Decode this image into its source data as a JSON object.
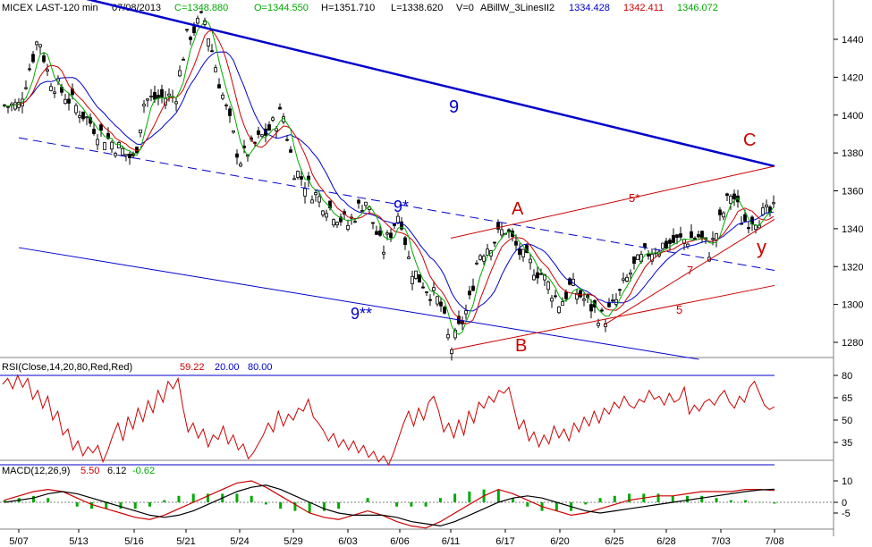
{
  "header": {
    "symbol": "MICEX LAST-120 min",
    "date": "07/08/2013",
    "close": "C=1348.880",
    "open": "O=1344.550",
    "high": "H=1351.710",
    "low": "L=1338.620",
    "volume": "V=0",
    "indicator": "ABillW_3LinesII2",
    "ind_blue": "1334.428",
    "ind_red": "1342.411",
    "ind_green": "1346.072"
  },
  "rsi_header": {
    "label": "RSI(Close,14,20,80,Red,Red)",
    "value": "59.22",
    "lower": "20.00",
    "upper": "80.00"
  },
  "macd_header": {
    "label": "MACD(12,26,9)",
    "macd": "5.50",
    "signal": "6.12",
    "hist": "-0.62"
  },
  "colors": {
    "price": "#000000",
    "blue": "#0000cc",
    "red": "#cc0000",
    "green": "#00aa00",
    "grid": "#808080"
  },
  "chart_data": [
    {
      "type": "candlestick",
      "title": "MICEX LAST-120 min",
      "x_ticks": [
        "5/07",
        "5/13",
        "5/16",
        "5/21",
        "5/24",
        "5/29",
        "6/03",
        "6/06",
        "6/11",
        "6/17",
        "6/20",
        "6/25",
        "6/28",
        "7/03",
        "7/08"
      ],
      "y_ticks": [
        1280,
        1300,
        1320,
        1340,
        1360,
        1380,
        1400,
        1420,
        1440
      ],
      "ylim": [
        1268,
        1452
      ],
      "grid": false,
      "key_points": [
        {
          "x": "5/07",
          "y": 1405
        },
        {
          "x": "5/09",
          "y": 1442
        },
        {
          "x": "5/10",
          "y": 1420
        },
        {
          "x": "5/13",
          "y": 1403
        },
        {
          "x": "5/14",
          "y": 1392
        },
        {
          "x": "5/16",
          "y": 1376
        },
        {
          "x": "5/17",
          "y": 1408
        },
        {
          "x": "5/20",
          "y": 1410
        },
        {
          "x": "5/21",
          "y": 1440
        },
        {
          "x": "5/22",
          "y": 1452
        },
        {
          "x": "5/23",
          "y": 1412
        },
        {
          "x": "5/24",
          "y": 1376
        },
        {
          "x": "5/27",
          "y": 1394
        },
        {
          "x": "5/28",
          "y": 1402
        },
        {
          "x": "5/29",
          "y": 1372
        },
        {
          "x": "5/31",
          "y": 1358
        },
        {
          "x": "6/03",
          "y": 1342
        },
        {
          "x": "6/04",
          "y": 1356
        },
        {
          "x": "6/05",
          "y": 1328
        },
        {
          "x": "6/06",
          "y": 1350
        },
        {
          "x": "6/07",
          "y": 1320
        },
        {
          "x": "6/10",
          "y": 1300
        },
        {
          "x": "6/11",
          "y": 1276
        },
        {
          "x": "6/13",
          "y": 1300
        },
        {
          "x": "6/14",
          "y": 1326
        },
        {
          "x": "6/17",
          "y": 1340
        },
        {
          "x": "6/18",
          "y": 1324
        },
        {
          "x": "6/19",
          "y": 1316
        },
        {
          "x": "6/20",
          "y": 1300
        },
        {
          "x": "6/21",
          "y": 1310
        },
        {
          "x": "6/24",
          "y": 1292
        },
        {
          "x": "6/25",
          "y": 1300
        },
        {
          "x": "6/26",
          "y": 1318
        },
        {
          "x": "6/27",
          "y": 1328
        },
        {
          "x": "6/28",
          "y": 1332
        },
        {
          "x": "7/01",
          "y": 1336
        },
        {
          "x": "7/02",
          "y": 1328
        },
        {
          "x": "7/03",
          "y": 1345
        },
        {
          "x": "7/04",
          "y": 1360
        },
        {
          "x": "7/05",
          "y": 1344
        },
        {
          "x": "7/08",
          "y": 1349
        }
      ],
      "channel_lines": [
        {
          "label": "9",
          "color": "#0000cc",
          "style": "solid",
          "from": {
            "x": "5/07",
            "y": 1470
          },
          "to": {
            "x": "7/08",
            "y": 1373
          }
        },
        {
          "label": "9*",
          "color": "#0000cc",
          "style": "dashed",
          "from": {
            "x": "5/07",
            "y": 1388
          },
          "to": {
            "x": "7/08",
            "y": 1318
          }
        },
        {
          "label": "9**",
          "color": "#0000cc",
          "style": "solid",
          "from": {
            "x": "5/07",
            "y": 1330
          },
          "to": {
            "x": "7/01",
            "y": 1271
          }
        },
        {
          "label": "5*",
          "color": "#cc0000",
          "style": "solid",
          "from": {
            "x": "6/11",
            "y": 1335
          },
          "to": {
            "x": "7/08",
            "y": 1373
          }
        },
        {
          "label": "5",
          "color": "#cc0000",
          "style": "solid",
          "from": {
            "x": "6/11",
            "y": 1276
          },
          "to": {
            "x": "7/08",
            "y": 1310
          }
        },
        {
          "label": "7",
          "color": "#cc0000",
          "style": "solid",
          "from": {
            "x": "6/24",
            "y": 1289
          },
          "to": {
            "x": "7/08",
            "y": 1345
          }
        }
      ],
      "annotations": [
        {
          "text": "9",
          "color": "#0000cc"
        },
        {
          "text": "9*",
          "color": "#0000cc"
        },
        {
          "text": "9**",
          "color": "#0000cc"
        },
        {
          "text": "A",
          "color": "#cc0000"
        },
        {
          "text": "B",
          "color": "#cc0000"
        },
        {
          "text": "C",
          "color": "#cc0000"
        },
        {
          "text": "5*",
          "color": "#cc0000"
        },
        {
          "text": "5",
          "color": "#cc0000"
        },
        {
          "text": "7",
          "color": "#cc0000"
        },
        {
          "text": "y",
          "color": "#cc0000"
        }
      ]
    },
    {
      "type": "line",
      "title": "RSI(Close,14,20,80,Red,Red)",
      "y_ticks": [
        35,
        50,
        65,
        80
      ],
      "ylim": [
        20,
        80
      ],
      "thresholds": [
        20,
        80
      ],
      "values": [
        74,
        78,
        71,
        80,
        72,
        78,
        64,
        70,
        58,
        66,
        50,
        56,
        40,
        44,
        30,
        36,
        26,
        32,
        28,
        33,
        22,
        30,
        40,
        48,
        36,
        52,
        44,
        58,
        49,
        63,
        55,
        70,
        62,
        76,
        71,
        78,
        58,
        42,
        48,
        38,
        44,
        32,
        40,
        37,
        46,
        34,
        40,
        30,
        34,
        24,
        28,
        34,
        40,
        48,
        42,
        56,
        46,
        54,
        50,
        58,
        56,
        64,
        52,
        48,
        43,
        36,
        41,
        32,
        37,
        30,
        36,
        28,
        33,
        25,
        29,
        22,
        26,
        20,
        28,
        38,
        48,
        56,
        46,
        58,
        50,
        62,
        66,
        56,
        42,
        48,
        38,
        50,
        40,
        56,
        48,
        62,
        58,
        66,
        62,
        70,
        68,
        72,
        58,
        44,
        50,
        36,
        42,
        32,
        40,
        34,
        46,
        38,
        44,
        36,
        48,
        42,
        52,
        46,
        56,
        48,
        58,
        54,
        62,
        58,
        66,
        60,
        58,
        64,
        62,
        70,
        64,
        66,
        60,
        68,
        62,
        64,
        72,
        54,
        60,
        56,
        62,
        64,
        60,
        66,
        70,
        62,
        58,
        66,
        62,
        72,
        76,
        68,
        60,
        57,
        59
      ]
    },
    {
      "type": "line",
      "title": "MACD(12,26,9)",
      "y_ticks": [
        10,
        0,
        -5
      ],
      "ylim": [
        -12,
        14
      ],
      "series": [
        {
          "name": "MACD",
          "values": [
            1,
            3,
            5,
            6,
            5,
            2,
            -1,
            -3,
            -5,
            -7,
            -8,
            -6,
            -3,
            0,
            3,
            6,
            9,
            10,
            7,
            3,
            -1,
            -5,
            -7,
            -8,
            -6,
            -4,
            -6,
            -9,
            -11,
            -12,
            -9,
            -5,
            -1,
            3,
            6,
            4,
            1,
            -2,
            -4,
            -6,
            -5,
            -3,
            -1,
            1,
            2,
            3,
            3,
            4,
            5,
            5,
            5,
            6,
            6,
            5.5
          ]
        },
        {
          "name": "Signal",
          "values": [
            0,
            1,
            2,
            4,
            5,
            4,
            2,
            0,
            -2,
            -4,
            -6,
            -7,
            -6,
            -4,
            -1,
            2,
            5,
            7,
            8,
            6,
            3,
            0,
            -3,
            -5,
            -6,
            -6,
            -6,
            -7,
            -9,
            -10,
            -11,
            -9,
            -6,
            -3,
            0,
            2,
            3,
            2,
            0,
            -2,
            -4,
            -5,
            -4,
            -3,
            -2,
            -1,
            0,
            1,
            2,
            3,
            4,
            5,
            5.8,
            6.1
          ]
        }
      ]
    }
  ]
}
